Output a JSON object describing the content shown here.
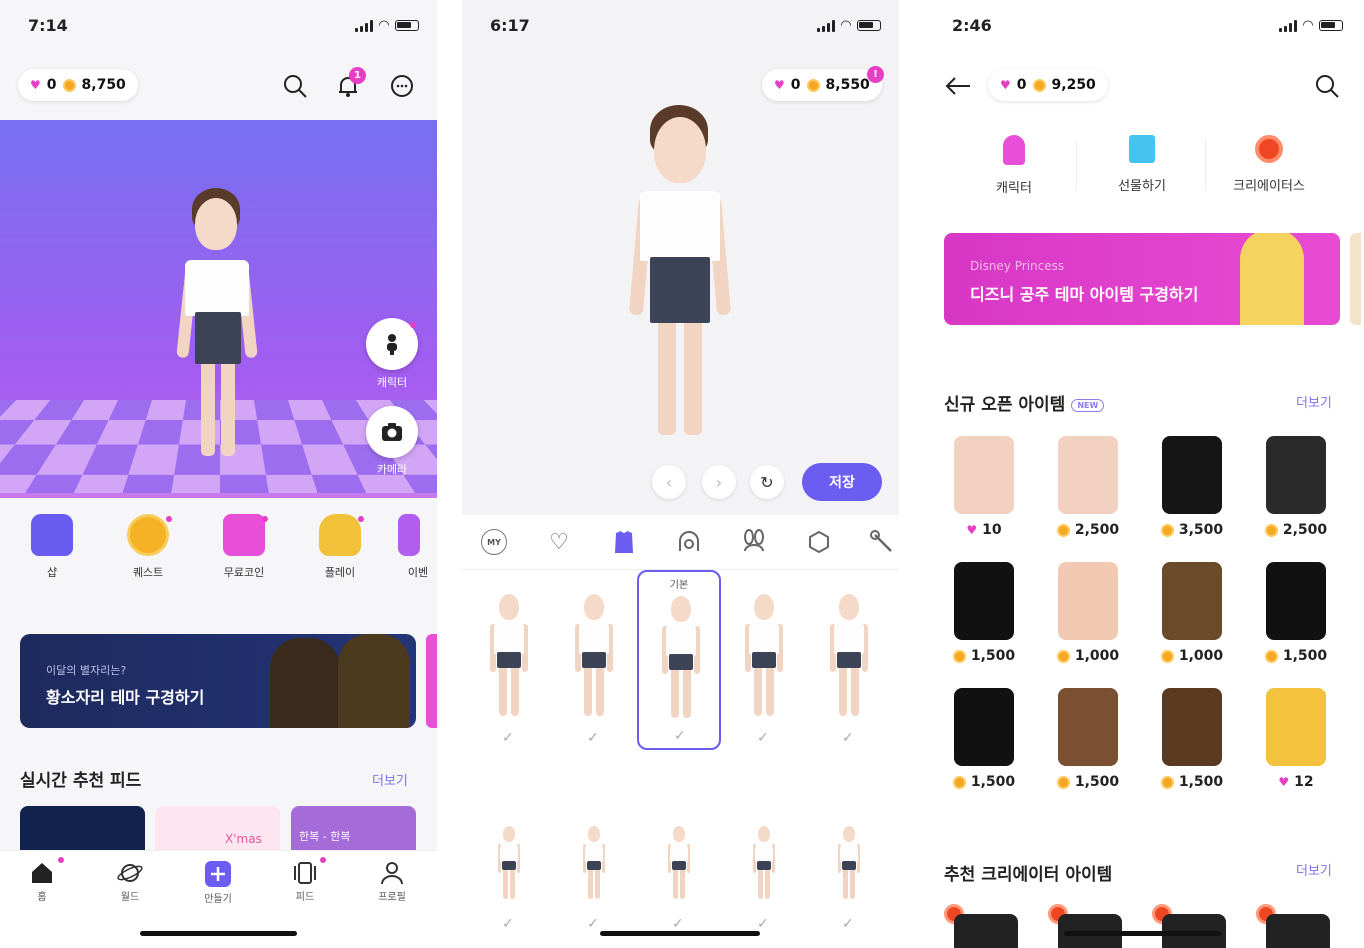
{
  "screen1": {
    "time": "7:14",
    "gems": "0",
    "coins": "8,750",
    "notification_count": "1",
    "character_fab": "캐릭터",
    "camera_fab": "카메라",
    "menu": [
      "샵",
      "퀘스트",
      "무료코인",
      "플레이",
      "이벤"
    ],
    "banner_sub": "이달의 별자리는?",
    "banner_title": "황소자리 테마 구경하기",
    "feed_title": "실시간 추천 피드",
    "feed_more": "더보기",
    "feed_thumb_2": "X'mas",
    "feed_thumb_3": "한복 - 한복",
    "tabs": [
      "홈",
      "월드",
      "만들기",
      "피드",
      "프로필"
    ]
  },
  "screen2": {
    "time": "6:17",
    "gems": "0",
    "coins": "8,550",
    "alert": "!",
    "save": "저장",
    "cat_my": "MY",
    "selected_label": "기본",
    "checkmark": "✓"
  },
  "screen3": {
    "time": "2:46",
    "gems": "0",
    "coins": "9,250",
    "top_menu": [
      "캐릭터",
      "선물하기",
      "크리에이터스"
    ],
    "banner_sub": "Disney Princess",
    "banner_title": "디즈니 공주 테마 아이템 구경하기",
    "new_title": "신규 오픈 아이템",
    "new_badge": "NEW",
    "new_more": "더보기",
    "items": [
      {
        "price": "10",
        "currency": "gem",
        "color": "#f2d1c0"
      },
      {
        "price": "2,500",
        "currency": "coin",
        "color": "#f2d1c0"
      },
      {
        "price": "3,500",
        "currency": "coin",
        "color": "#151515"
      },
      {
        "price": "2,500",
        "currency": "coin",
        "color": "#2a2a2a"
      },
      {
        "price": "1,500",
        "currency": "coin",
        "color": "#111111"
      },
      {
        "price": "1,000",
        "currency": "coin",
        "color": "#f2c9b2"
      },
      {
        "price": "1,000",
        "currency": "coin",
        "color": "#6b4a2a"
      },
      {
        "price": "1,500",
        "currency": "coin",
        "color": "#111111"
      },
      {
        "price": "1,500",
        "currency": "coin",
        "color": "#111111"
      },
      {
        "price": "1,500",
        "currency": "coin",
        "color": "#7a4f32"
      },
      {
        "price": "1,500",
        "currency": "coin",
        "color": "#5b3a22"
      },
      {
        "price": "12",
        "currency": "gem",
        "color": "#f3c33d"
      }
    ],
    "creator_title": "추천 크리에이터 아이템",
    "creator_more": "더보기"
  }
}
